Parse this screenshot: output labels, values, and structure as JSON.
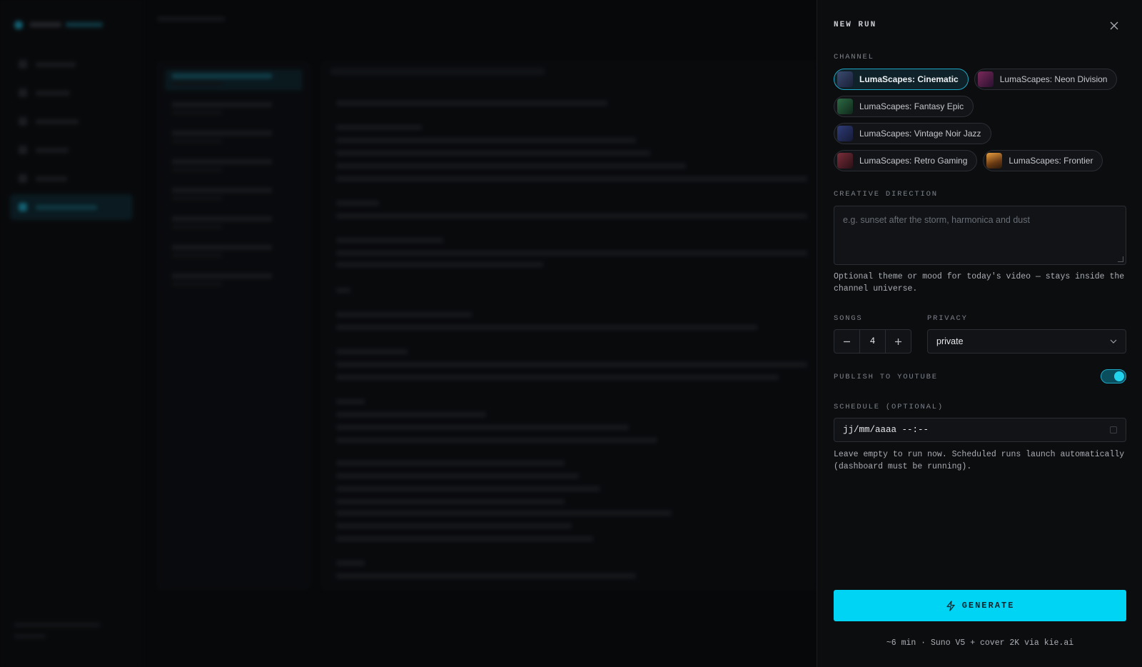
{
  "panel": {
    "title": "NEW RUN",
    "channel_label": "CHANNEL",
    "channels": [
      {
        "label": "LumaScapes: Cinematic",
        "selected": true,
        "thumb_color": "#2b3550"
      },
      {
        "label": "LumaScapes: Neon Division",
        "selected": false,
        "thumb_color": "#5a2344"
      },
      {
        "label": "LumaScapes: Fantasy Epic",
        "selected": false,
        "thumb_color": "#1f5034"
      },
      {
        "label": "LumaScapes: Vintage Noir Jazz",
        "selected": false,
        "thumb_color": "#26305a"
      },
      {
        "label": "LumaScapes: Retro Gaming",
        "selected": false,
        "thumb_color": "#5a2530"
      },
      {
        "label": "LumaScapes: Frontier",
        "selected": false,
        "thumb_color": "#8a5a24"
      }
    ],
    "creative_label": "CREATIVE DIRECTION",
    "creative_placeholder": "e.g. sunset after the storm, harmonica and dust",
    "creative_help": "Optional theme or mood for today's video — stays inside the channel universe.",
    "songs_label": "SONGS",
    "songs_value": "4",
    "privacy_label": "PRIVACY",
    "privacy_value": "private",
    "publish_label": "PUBLISH TO YOUTUBE",
    "publish_on": true,
    "schedule_label": "SCHEDULE (OPTIONAL)",
    "schedule_value": "jj/mm/aaaa --:--",
    "schedule_help": "Leave empty to run now. Scheduled runs launch automatically (dashboard must be running).",
    "generate_label": "GENERATE",
    "footer_note": "~6 min · Suno V5 + cover 2K via kie.ai"
  },
  "colors": {
    "accent": "#00d4f5",
    "panel_bg": "#0c0d0f"
  }
}
